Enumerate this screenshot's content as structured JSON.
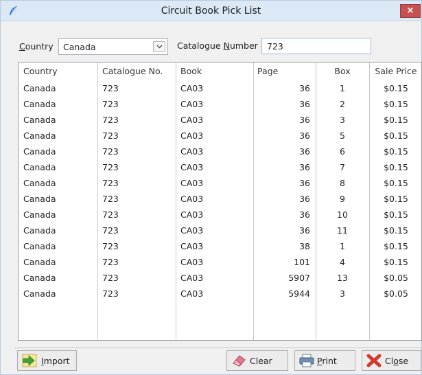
{
  "window": {
    "title": "Circuit Book Pick List",
    "close_glyph": "×"
  },
  "filters": {
    "country_label_first": "C",
    "country_label_rest": "ountry",
    "country_value": "Canada",
    "catalogue_label_start": "Catalogue ",
    "catalogue_label_u": "N",
    "catalogue_label_end": "umber",
    "catalogue_value": "723"
  },
  "table": {
    "headers": [
      "Country",
      "Catalogue No.",
      "Book",
      "Page",
      "Box",
      "Sale Price"
    ],
    "rows": [
      [
        "Canada",
        "723",
        "CA03",
        "36",
        "1",
        "$0.15"
      ],
      [
        "Canada",
        "723",
        "CA03",
        "36",
        "2",
        "$0.15"
      ],
      [
        "Canada",
        "723",
        "CA03",
        "36",
        "3",
        "$0.15"
      ],
      [
        "Canada",
        "723",
        "CA03",
        "36",
        "5",
        "$0.15"
      ],
      [
        "Canada",
        "723",
        "CA03",
        "36",
        "6",
        "$0.15"
      ],
      [
        "Canada",
        "723",
        "CA03",
        "36",
        "7",
        "$0.15"
      ],
      [
        "Canada",
        "723",
        "CA03",
        "36",
        "8",
        "$0.15"
      ],
      [
        "Canada",
        "723",
        "CA03",
        "36",
        "9",
        "$0.15"
      ],
      [
        "Canada",
        "723",
        "CA03",
        "36",
        "10",
        "$0.15"
      ],
      [
        "Canada",
        "723",
        "CA03",
        "36",
        "11",
        "$0.15"
      ],
      [
        "Canada",
        "723",
        "CA03",
        "38",
        "1",
        "$0.15"
      ],
      [
        "Canada",
        "723",
        "CA03",
        "101",
        "4",
        "$0.15"
      ],
      [
        "Canada",
        "723",
        "CA03",
        "5907",
        "13",
        "$0.05"
      ],
      [
        "Canada",
        "723",
        "CA03",
        "5944",
        "3",
        "$0.05"
      ]
    ]
  },
  "buttons": {
    "import_u": "I",
    "import_rest": "mport",
    "clear": "Clear",
    "print_u": "P",
    "print_rest": "rint",
    "close_start": "Cl",
    "close_u": "o",
    "close_end": "se"
  },
  "icons": {
    "app": "blue-feather-icon",
    "import": "import-arrow-icon",
    "clear": "eraser-icon",
    "print": "printer-icon",
    "close": "red-x-icon"
  }
}
